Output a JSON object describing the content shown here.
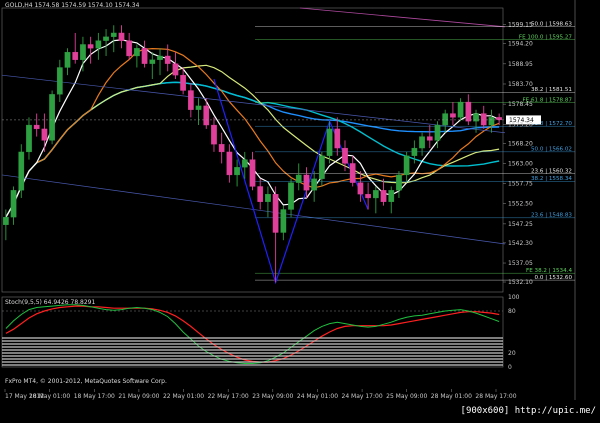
{
  "chart_data": {
    "type": "candlestick",
    "header": "GOLD,H4  1574.58  1574.59  1574.10  1574.34",
    "current_price": 1574.34,
    "price_axis": {
      "ylim": [
        1529.5,
        1603.5
      ],
      "ticks": [
        "1599.15",
        "1594.20",
        "1588.95",
        "1583.70",
        "1578.45",
        "1573.20",
        "1568.20",
        "1563.00",
        "1557.75",
        "1552.50",
        "1547.25",
        "1542.30",
        "1537.05",
        "1532.10"
      ]
    },
    "time_axis": {
      "labels": [
        "17 May 2012",
        "18 May 01:00",
        "18 May 17:00",
        "21 May 09:00",
        "22 May 01:00",
        "22 May 17:00",
        "23 May 09:00",
        "24 May 01:00",
        "24 May 17:00",
        "25 May 09:00",
        "28 May 01:00",
        "28 May 17:00"
      ]
    },
    "candles": [
      [
        1547,
        1551,
        1543,
        1549
      ],
      [
        1549,
        1557,
        1547,
        1556
      ],
      [
        1556,
        1568,
        1554,
        1566
      ],
      [
        1566,
        1575,
        1564,
        1573
      ],
      [
        1573,
        1576,
        1570,
        1572
      ],
      [
        1572,
        1576,
        1566,
        1569
      ],
      [
        1569,
        1582,
        1568,
        1581
      ],
      [
        1581,
        1590,
        1579,
        1588
      ],
      [
        1588,
        1593,
        1586,
        1592
      ],
      [
        1592,
        1597,
        1589,
        1590
      ],
      [
        1590,
        1596,
        1587,
        1594
      ],
      [
        1594,
        1596,
        1589,
        1593
      ],
      [
        1593,
        1597,
        1590,
        1595
      ],
      [
        1595,
        1598,
        1591,
        1596
      ],
      [
        1596,
        1599,
        1592,
        1597
      ],
      [
        1597,
        1599,
        1593,
        1595
      ],
      [
        1595,
        1597,
        1590,
        1591
      ],
      [
        1591,
        1594,
        1588,
        1593
      ],
      [
        1593,
        1595,
        1588,
        1589
      ],
      [
        1589,
        1592,
        1585,
        1590
      ],
      [
        1590,
        1593,
        1586,
        1591
      ],
      [
        1591,
        1594,
        1587,
        1589
      ],
      [
        1589,
        1592,
        1585,
        1586
      ],
      [
        1586,
        1588,
        1581,
        1582
      ],
      [
        1582,
        1584,
        1575,
        1577
      ],
      [
        1577,
        1580,
        1573,
        1578
      ],
      [
        1578,
        1580,
        1572,
        1573
      ],
      [
        1573,
        1575,
        1566,
        1568
      ],
      [
        1568,
        1571,
        1563,
        1566
      ],
      [
        1566,
        1568,
        1558,
        1560
      ],
      [
        1560,
        1564,
        1557,
        1562
      ],
      [
        1562,
        1566,
        1559,
        1564
      ],
      [
        1564,
        1566,
        1556,
        1557
      ],
      [
        1557,
        1559,
        1551,
        1553
      ],
      [
        1553,
        1557,
        1549,
        1555
      ],
      [
        1555,
        1557,
        1532,
        1545
      ],
      [
        1545,
        1552,
        1543,
        1551
      ],
      [
        1551,
        1559,
        1549,
        1558
      ],
      [
        1558,
        1563,
        1556,
        1560
      ],
      [
        1560,
        1562,
        1554,
        1556
      ],
      [
        1556,
        1561,
        1553,
        1559
      ],
      [
        1559,
        1566,
        1557,
        1565
      ],
      [
        1565,
        1574,
        1563,
        1572
      ],
      [
        1572,
        1575,
        1565,
        1567
      ],
      [
        1567,
        1569,
        1561,
        1563
      ],
      [
        1563,
        1565,
        1557,
        1558
      ],
      [
        1558,
        1561,
        1553,
        1555
      ],
      [
        1555,
        1558,
        1551,
        1554
      ],
      [
        1554,
        1557,
        1550,
        1556
      ],
      [
        1556,
        1559,
        1552,
        1553
      ],
      [
        1553,
        1557,
        1550,
        1556
      ],
      [
        1556,
        1561,
        1554,
        1560
      ],
      [
        1560,
        1566,
        1558,
        1565
      ],
      [
        1565,
        1569,
        1563,
        1567
      ],
      [
        1567,
        1571,
        1565,
        1570
      ],
      [
        1570,
        1573,
        1567,
        1569
      ],
      [
        1569,
        1574,
        1567,
        1573
      ],
      [
        1573,
        1577,
        1571,
        1576
      ],
      [
        1576,
        1579,
        1573,
        1575
      ],
      [
        1575,
        1580,
        1574,
        1579
      ],
      [
        1579,
        1581,
        1573,
        1574
      ],
      [
        1574,
        1577,
        1571,
        1576
      ],
      [
        1576,
        1578,
        1572,
        1573
      ],
      [
        1573,
        1577,
        1571,
        1575
      ],
      [
        1575,
        1576,
        1573,
        1574.34
      ]
    ],
    "levels": [
      {
        "label": "50.0 | 1598.63",
        "price": 1598.63,
        "color": "#e8e8e8"
      },
      {
        "label": "FE 100.0 | 1595.27",
        "price": 1595.27,
        "color": "#5fd35f"
      },
      {
        "label": "38.2 | 1581.51",
        "price": 1581.51,
        "color": "#e8e8e8"
      },
      {
        "label": "FE 61.8 | 1578.87",
        "price": 1578.87,
        "color": "#5fd35f"
      },
      {
        "label": "61.8 | 1572.70",
        "price": 1572.7,
        "color": "#3f9fe0"
      },
      {
        "label": "50.0 | 1566.02",
        "price": 1566.02,
        "color": "#3f9fe0"
      },
      {
        "label": "23.6 | 1560.32",
        "price": 1560.32,
        "color": "#e8e8e8"
      },
      {
        "label": "38.2 | 1558.34",
        "price": 1558.34,
        "color": "#3f9fe0"
      },
      {
        "label": "23.6 | 1548.83",
        "price": 1548.83,
        "color": "#3f9fe0"
      },
      {
        "label": "FE 38.2 | 1534.4",
        "price": 1534.4,
        "color": "#5fd35f"
      },
      {
        "label": "0.0 | 1532.60",
        "price": 1532.6,
        "color": "#e8e8e8"
      }
    ],
    "stoch": {
      "label": "Stoch(9,5,5) 64.9426 78.8291",
      "ylim": [
        0,
        100
      ],
      "ticks": [
        "100",
        "80",
        "20",
        "0"
      ],
      "k": [
        55,
        66,
        75,
        82,
        85,
        86,
        87,
        88,
        89,
        89,
        88,
        86,
        84,
        82,
        81,
        82,
        84,
        85,
        84,
        82,
        78,
        72,
        62,
        50,
        40,
        30,
        22,
        16,
        11,
        8,
        6,
        5,
        5,
        6,
        9,
        14,
        20,
        28,
        36,
        44,
        52,
        58,
        62,
        64,
        62,
        60,
        58,
        57,
        58,
        61,
        64,
        68,
        71,
        73,
        74,
        76,
        78,
        80,
        81,
        82,
        80,
        77,
        73,
        69,
        65
      ],
      "d": [
        48,
        54,
        62,
        70,
        76,
        80,
        83,
        85,
        86,
        87,
        87,
        86,
        86,
        85,
        84,
        84,
        84,
        84,
        84,
        83,
        81,
        78,
        73,
        66,
        58,
        49,
        40,
        32,
        25,
        19,
        14,
        10,
        8,
        7,
        7,
        9,
        12,
        17,
        23,
        30,
        37,
        44,
        50,
        55,
        58,
        59,
        59,
        59,
        59,
        59,
        60,
        62,
        64,
        66,
        68,
        70,
        72,
        74,
        76,
        78,
        79,
        79,
        78,
        77,
        75
      ]
    },
    "copyright": "FxPro MT4, © 2001-2012, MetaQuotes Software Corp.",
    "watermark": "[900x600] http://upic.me/"
  }
}
